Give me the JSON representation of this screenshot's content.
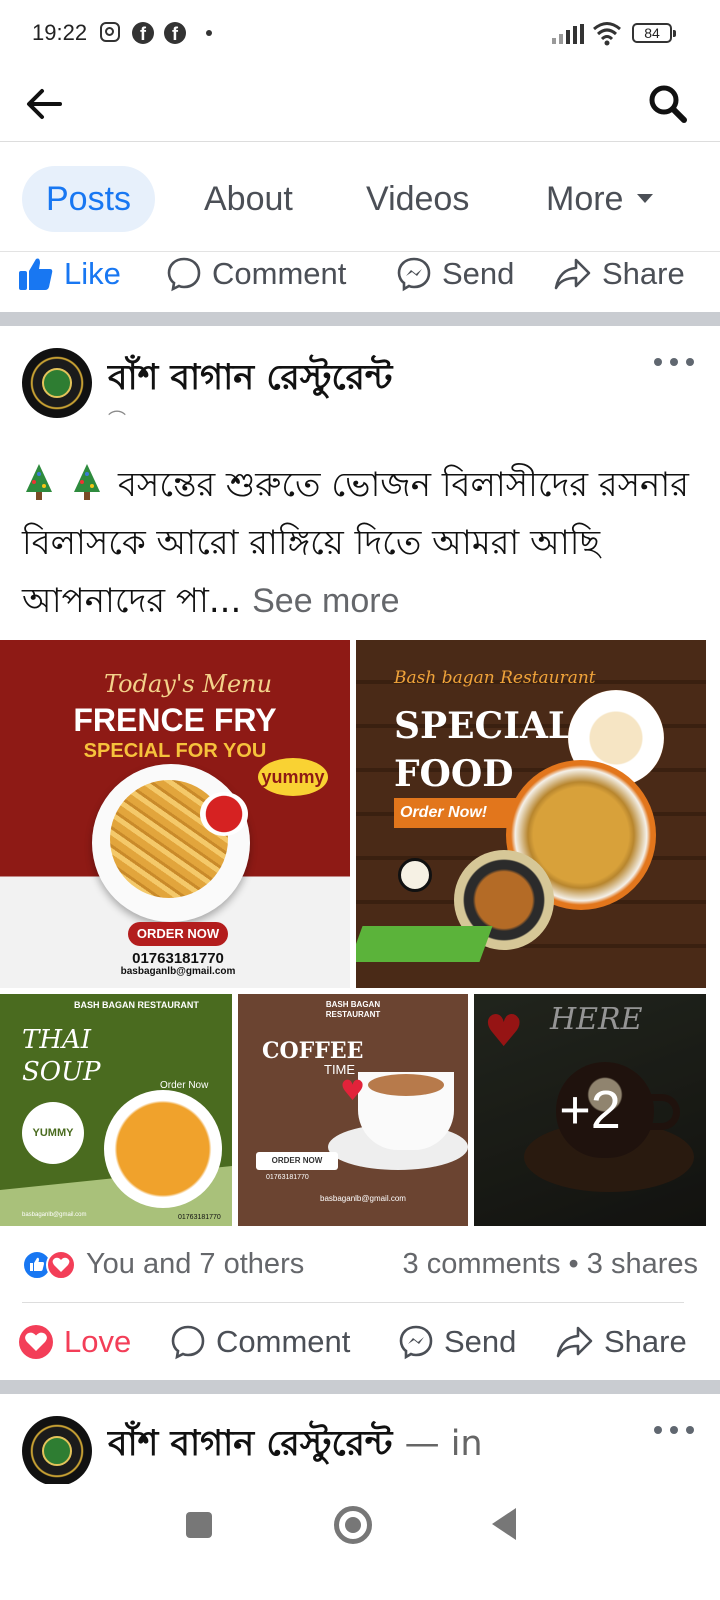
{
  "status_bar": {
    "time": "19:22",
    "battery": "84"
  },
  "tabs": [
    {
      "label": "Posts",
      "active": true
    },
    {
      "label": "About",
      "active": false
    },
    {
      "label": "Videos",
      "active": false
    },
    {
      "label": "More",
      "active": false
    }
  ],
  "action_bar_top": {
    "like": "Like",
    "comment": "Comment",
    "send": "Send",
    "share": "Share"
  },
  "post": {
    "page_name": "বাঁশ বাগান রেস্টুরেন্ট",
    "text": "বসন্তের শুরুতে ভোজন বিলাসীদের রসনার বিলাসকে আরো রাঙ্গিয়ে দিতে আমরা আছি আপনাদের পা...",
    "see_more": "See more",
    "images": {
      "fries": {
        "script": "Today's Menu",
        "title": "FRENCE FRY",
        "subtitle": "SPECIAL FOR YOU",
        "badge": "yummy",
        "cta": "ORDER NOW",
        "phone": "01763181770",
        "email": "basbaganlb@gmail.com"
      },
      "special": {
        "script": "Bash bagan Restaurant",
        "title_line1": "SPECIAL",
        "title_line2": "FOOD",
        "cta": "Order Now!"
      },
      "soup": {
        "brand": "BASH BAGAN RESTAURANT",
        "title_line1": "THAI",
        "title_line2": "SOUP",
        "order": "Order Now",
        "badge": "YUMMY",
        "email": "basbaganlb@gmail.com",
        "phone": "01763181770"
      },
      "coffee": {
        "brand_line1": "BASH BAGAN",
        "brand_line2": "RESTAURANT",
        "title": "COFFEE",
        "subtitle": "TIME",
        "cta": "ORDER NOW",
        "phone": "01763181770",
        "email": "basbaganlb@gmail.com"
      },
      "here": {
        "script": "HERE",
        "more_count": "+2"
      }
    },
    "reactions": {
      "summary": "You and 7 others",
      "comments": "3 comments",
      "shares": "3 shares"
    },
    "actions": {
      "love": "Love",
      "comment": "Comment",
      "send": "Send",
      "share": "Share"
    }
  },
  "next_post": {
    "page_name": "বাঁশ বাগান রেস্টুরেন্ট",
    "suffix": "— in"
  },
  "colors": {
    "accent": "#1877f2",
    "love": "#f33e58",
    "divider": "#c9ccd1"
  }
}
